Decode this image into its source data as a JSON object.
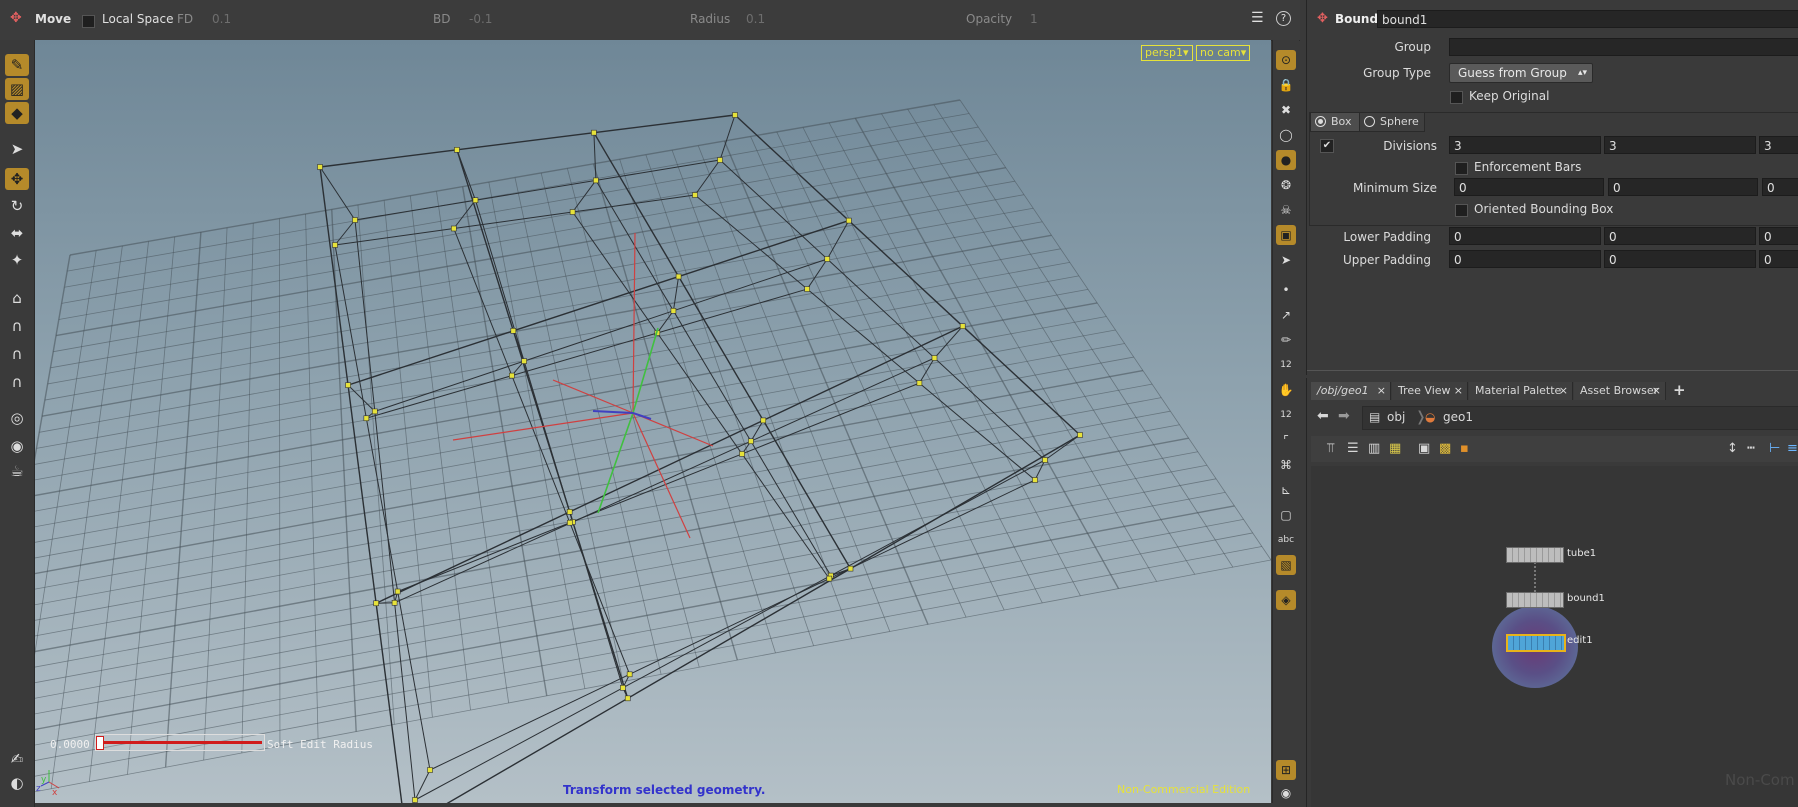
{
  "toolbar": {
    "tool_name": "Move",
    "local_space_label": "Local Space",
    "fd_label": "FD",
    "fd_value": "0.1",
    "bd_label": "BD",
    "bd_value": "-0.1",
    "radius_label": "Radius",
    "radius_value": "0.1",
    "opacity_label": "Opacity",
    "opacity_value": "1",
    "help_icon": "?"
  },
  "viewport": {
    "camera_menu": "persp1▾",
    "cam_menu": "no cam▾",
    "soft_value": "0.0000",
    "soft_label": "Soft Edit Radius",
    "status_text": "Transform selected geometry.",
    "edition_text": "Non-Commercial Edition",
    "axis_x": "x",
    "axis_y": "y",
    "axis_z": "z",
    "colors": {
      "status": "#3333cc",
      "edition": "#e6e23a",
      "handle_x": "#d04040",
      "handle_y": "#40c040",
      "handle_z": "#4040c0",
      "points": "#e6e23a"
    }
  },
  "params": {
    "node_type": "Bound",
    "node_name": "bound1",
    "group_label": "Group",
    "group_value": "",
    "group_type_label": "Group Type",
    "group_type_value": "Guess from Group",
    "keep_original_label": "Keep Original",
    "box_label": "Box",
    "sphere_label": "Sphere",
    "divisions_label": "Divisions",
    "divisions": [
      "3",
      "3",
      "3"
    ],
    "enforcement_bars_label": "Enforcement Bars",
    "min_size_label": "Minimum Size",
    "min_size": [
      "0",
      "0",
      "0"
    ],
    "oriented_bbox_label": "Oriented Bounding Box",
    "lower_padding_label": "Lower Padding",
    "lower_padding": [
      "0",
      "0",
      "0"
    ],
    "upper_padding_label": "Upper Padding",
    "upper_padding": [
      "0",
      "0",
      "0"
    ]
  },
  "network": {
    "tabs": [
      {
        "label": "/obj/geo1",
        "close": "×"
      },
      {
        "label": "Tree View",
        "close": "×"
      },
      {
        "label": "Material Palette",
        "close": "×"
      },
      {
        "label": "Asset Browser",
        "close": "×"
      }
    ],
    "add_tab": "+",
    "path_root": "obj",
    "path_child": "geo1",
    "nodes": [
      {
        "label": "tube1"
      },
      {
        "label": "bound1"
      },
      {
        "label": "edit1"
      }
    ],
    "watermark": "Non-Com"
  }
}
